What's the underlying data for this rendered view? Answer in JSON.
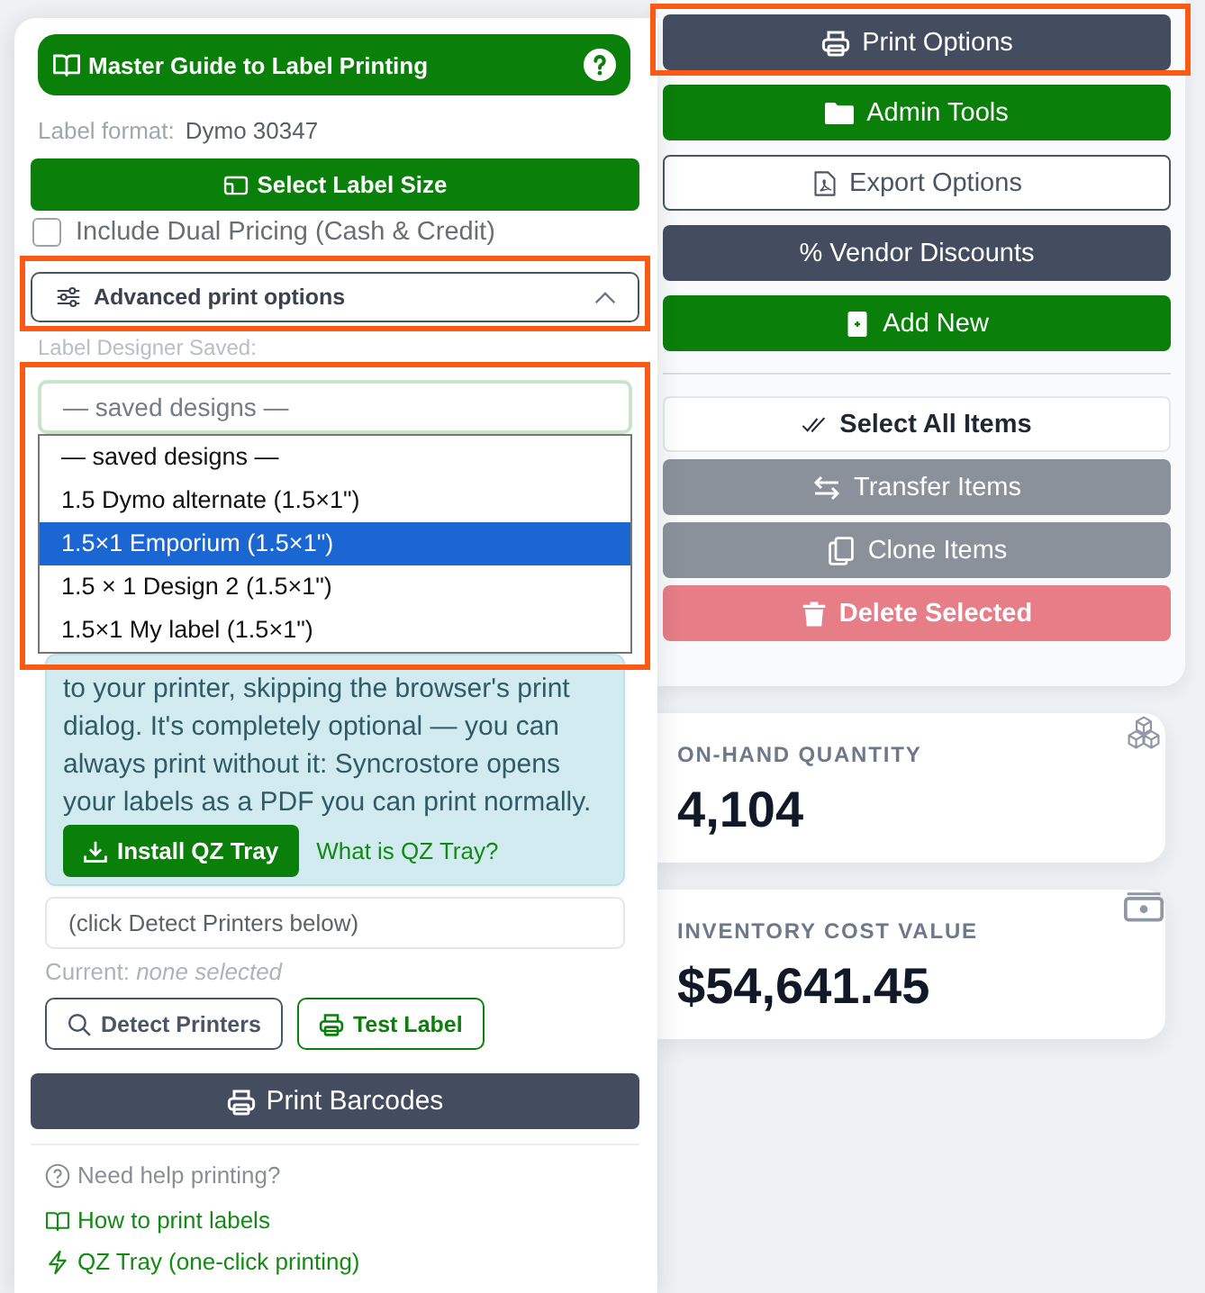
{
  "print_panel": {
    "guide_button": {
      "label": "Master Guide to Label Printing"
    },
    "label_format": {
      "label": "Label format:",
      "value": "Dymo 30347"
    },
    "size_button": {
      "label": "Select Label Size"
    },
    "dual_pricing": {
      "label": "Include Dual Pricing (Cash & Credit)",
      "checked": false
    },
    "advanced_toggle": {
      "label": "Advanced print options",
      "expanded": true,
      "highlighted": true
    },
    "designer": {
      "label": "Label Designer Saved:",
      "placeholder": "— saved designs —",
      "open": true,
      "highlighted": true,
      "options": [
        {
          "label": "— saved designs —",
          "selected": false
        },
        {
          "label": "1.5 Dymo alternate (1.5×1\")",
          "selected": false
        },
        {
          "label": "1.5×1 Emporium (1.5×1\")",
          "selected": true
        },
        {
          "label": "1.5 × 1 Design 2 (1.5×1\")",
          "selected": false
        },
        {
          "label": "1.5×1 My label (1.5×1\")",
          "selected": false
        }
      ]
    },
    "qz_info": {
      "text": "to your printer, skipping the browser's print dialog. It's completely optional — you can always print without it: Syncrostore opens your labels as a PDF you can print normally.",
      "install_button": "Install QZ Tray",
      "link": "What is QZ Tray?"
    },
    "printer_field": {
      "value": "(click Detect Printers below)"
    },
    "current_printer": "Current: *none selected*",
    "printer_buttons": [
      {
        "label": "Detect Printers",
        "kind": "outline"
      },
      {
        "label": "Test Label",
        "kind": "success-outline"
      }
    ],
    "print_button": {
      "label": "Print Barcodes"
    },
    "help": {
      "title": "Need help printing?",
      "links": [
        "How to print labels",
        "QZ Tray (one-click printing)"
      ]
    }
  },
  "action_groups": [
    {
      "buttons": [
        {
          "label": "Print Options",
          "kind": "dark",
          "disabled": false,
          "highlighted": true
        },
        {
          "label": "Admin Tools",
          "kind": "success",
          "disabled": false,
          "highlighted": false
        },
        {
          "label": "Export Options",
          "kind": "outline",
          "disabled": false,
          "highlighted": false
        },
        {
          "label": "% Vendor Discounts",
          "kind": "dark",
          "disabled": false,
          "highlighted": false
        },
        {
          "label": "Add New",
          "kind": "success",
          "disabled": false,
          "highlighted": false
        }
      ]
    },
    {
      "buttons": [
        {
          "label": "Select All Items",
          "kind": "light",
          "disabled": false,
          "highlighted": false
        },
        {
          "label": "Transfer Items",
          "kind": "secondary",
          "disabled": true,
          "highlighted": false
        },
        {
          "label": "Clone Items",
          "kind": "secondary",
          "disabled": true,
          "highlighted": false
        },
        {
          "label": "Delete Selected",
          "kind": "danger",
          "disabled": true,
          "highlighted": false
        }
      ]
    }
  ],
  "stats": [
    {
      "label": "ON-HAND QUANTITY",
      "value": "4,104"
    },
    {
      "label": "INVENTORY COST VALUE",
      "value": "$54,641.45"
    }
  ]
}
